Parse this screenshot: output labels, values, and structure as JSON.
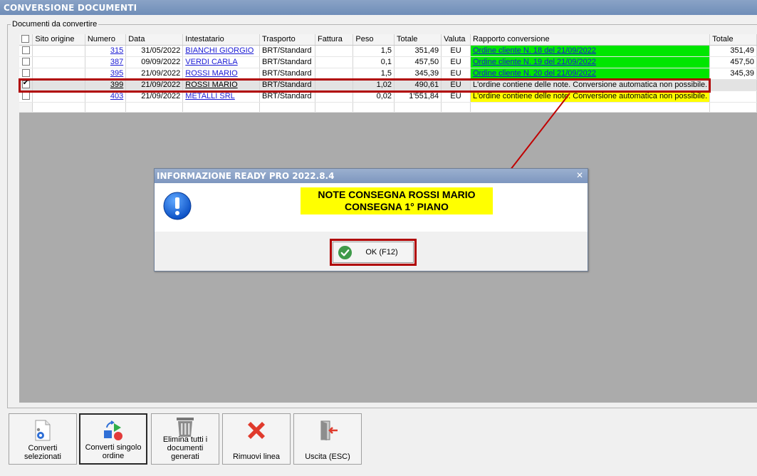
{
  "window": {
    "title": "CONVERSIONE DOCUMENTI"
  },
  "group": {
    "legend": "Documenti da convertire"
  },
  "table": {
    "columns": [
      "Sito origine",
      "Numero",
      "Data",
      "Intestatario",
      "Trasporto",
      "Fattura",
      "Peso",
      "Totale",
      "Valuta",
      "Rapporto conversione",
      "Totale"
    ],
    "rows": [
      {
        "checked": false,
        "sito": "",
        "numero": "315",
        "data": "31/05/2022",
        "intestatario": "BIANCHI GIORGIO",
        "trasporto": "BRT/Standard",
        "fattura": "",
        "peso": "1,5",
        "totale": "351,49",
        "valuta": "EU",
        "rapporto": "Ordine cliente N. 18 del 21/09/2022",
        "rapporto_status": "green",
        "totale2": "351,49"
      },
      {
        "checked": false,
        "sito": "",
        "numero": "387",
        "data": "09/09/2022",
        "intestatario": "VERDI CARLA",
        "trasporto": "BRT/Standard",
        "fattura": "",
        "peso": "0,1",
        "totale": "457,50",
        "valuta": "EU",
        "rapporto": "Ordine cliente N. 19 del 21/09/2022",
        "rapporto_status": "green",
        "totale2": "457,50"
      },
      {
        "checked": false,
        "sito": "",
        "numero": "395",
        "data": "21/09/2022",
        "intestatario": "ROSSI MARIO",
        "trasporto": "BRT/Standard",
        "fattura": "",
        "peso": "1,5",
        "totale": "345,39",
        "valuta": "EU",
        "rapporto": "Ordine cliente N. 20 del 21/09/2022",
        "rapporto_status": "green",
        "totale2": "345,39"
      },
      {
        "checked": true,
        "sito": "",
        "numero": "399",
        "data": "21/09/2022",
        "intestatario": "ROSSI MARIO",
        "trasporto": "BRT/Standard",
        "fattura": "",
        "peso": "1,02",
        "totale": "490,61",
        "valuta": "EU",
        "rapporto": "L'ordine contiene delle note. Conversione automatica non possibile.",
        "rapporto_status": "plain",
        "totale2": ""
      },
      {
        "checked": false,
        "sito": "",
        "numero": "403",
        "data": "21/09/2022",
        "intestatario": "METALLI SRL",
        "trasporto": "BRT/Standard",
        "fattura": "",
        "peso": "0,02",
        "totale": "1'551,84",
        "valuta": "EU",
        "rapporto": "L'ordine contiene delle note. Conversione automatica non possibile.",
        "rapporto_status": "yellow",
        "totale2": ""
      }
    ]
  },
  "dialog": {
    "title": "INFORMAZIONE READY PRO 2022.8.4",
    "close": "✕",
    "message_line1": "NOTE CONSEGNA ROSSI MARIO",
    "message_line2": "CONSEGNA 1° PIANO",
    "ok_label": "OK (F12)"
  },
  "toolbar": {
    "converti_selezionati": "Converti selezionati",
    "converti_singolo": "Converti singolo ordine",
    "elimina_tutti": "Elimina tutti i documenti generati",
    "rimuovi_linea": "Rimuovi linea",
    "uscita": "Uscita (ESC)"
  },
  "colors": {
    "green": "#00e600",
    "yellow": "#ffff00",
    "highlight_red": "#b00000",
    "link": "#1a1ad4"
  }
}
